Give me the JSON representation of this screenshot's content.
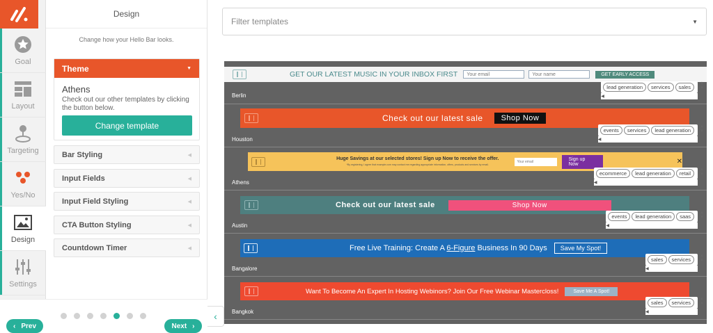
{
  "rail": {
    "items": [
      {
        "label": "Goal"
      },
      {
        "label": "Layout"
      },
      {
        "label": "Targeting"
      },
      {
        "label": "Yes/No"
      },
      {
        "label": "Design"
      },
      {
        "label": "Settings"
      }
    ],
    "accent": "#28b09a",
    "brand": "#e8562a"
  },
  "panel": {
    "title": "Design",
    "subtitle": "Change how your Hello Bar looks.",
    "theme": {
      "header": "Theme",
      "name": "Athens",
      "description": "Check out our other templates by clicking the button below.",
      "button": "Change template"
    },
    "sections": [
      "Bar Styling",
      "Input Fields",
      "Input Field Styling",
      "CTA Button Styling",
      "Countdown Timer"
    ],
    "footer": {
      "prev": "Prev",
      "next": "Next",
      "dots": 7,
      "active_dot": 5
    }
  },
  "main": {
    "filter_placeholder": "Filter templates",
    "templates": [
      {
        "name": "Berlin",
        "text": "GET OUR LATEST MUSIC IN YOUR INBOX FIRST",
        "inputs": [
          "Your email",
          "Your name"
        ],
        "cta": "GET EARLY ACCESS",
        "tags": [
          "lead generation",
          "services",
          "sales"
        ]
      },
      {
        "name": "Houston",
        "text": "Check out our latest sale",
        "cta": "Shop Now",
        "tags": [
          "events",
          "services",
          "lead generation"
        ]
      },
      {
        "name": "Athens",
        "text": "Huge Savings at our selected stores! Sign up Now to receive the offer.",
        "fineprint": "*By registering, I agree that example.com may contact me regarding appropriate information, offers, products and services by email.",
        "inputs": [
          "Your email"
        ],
        "cta": "Sign up Now",
        "close": "✕",
        "tags": [
          "ecommerce",
          "lead generation",
          "retail"
        ]
      },
      {
        "name": "Austin",
        "text": "Check out our latest sale",
        "cta": "Shop Now",
        "tags": [
          "events",
          "lead generation",
          "saas"
        ]
      },
      {
        "name": "Bangalore",
        "text_before": "Free Live Training: Create A ",
        "text_link": "6-Figure",
        "text_after": " Business In 90 Days",
        "cta": "Save My Spot!",
        "tags": [
          "sales",
          "services"
        ]
      },
      {
        "name": "Bangkok",
        "text": "Want To Become An Expert In Hosting Webinors? Join Our Free Webinar Mastercloss!",
        "cta": "Save Me A Spot!",
        "tags": [
          "sales",
          "services"
        ]
      }
    ]
  }
}
